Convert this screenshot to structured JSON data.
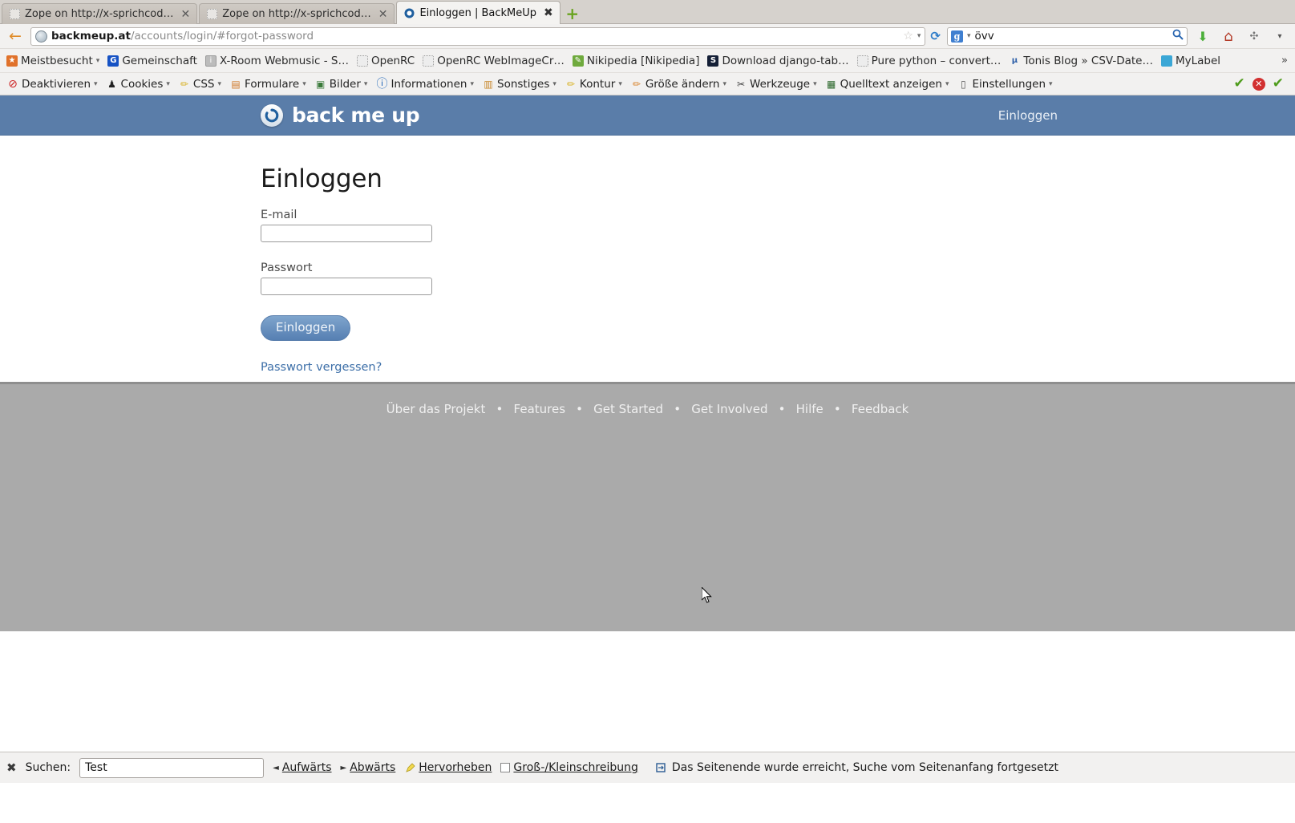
{
  "browser": {
    "tabs": [
      {
        "label": "Zope on http://x-sprichcod…",
        "active": false,
        "close": "✕",
        "favicon": "blank-favicon"
      },
      {
        "label": "Zope on http://x-sprichcod…",
        "active": false,
        "close": "✕",
        "favicon": "blank-favicon"
      },
      {
        "label": "Einloggen | BackMeUp",
        "active": true,
        "close": "✖",
        "favicon": "backmeup-favicon"
      }
    ],
    "new_tab_label": "+",
    "back_button": "←",
    "url": {
      "domain": "backmeup.at",
      "path": "/accounts/login/#forgot-password",
      "star": "☆",
      "caret": "▾",
      "reload": "⟳"
    },
    "search": {
      "engine_glyph": "g",
      "caret": "▾",
      "value": "övv",
      "magnifier": "🔍"
    },
    "nav_icons": [
      {
        "name": "downloads-icon",
        "glyph": "⬇",
        "color": "#4caf3a"
      },
      {
        "name": "home-icon",
        "glyph": "⌂",
        "color": "#b33a27"
      },
      {
        "name": "extension-icon",
        "glyph": "✣",
        "color": "#777777"
      },
      {
        "name": "overflow-caret-icon",
        "glyph": "▾",
        "color": "#555555"
      }
    ],
    "bookmarks": [
      {
        "label": "Meistbesucht",
        "icon": "f-orange",
        "glyph": "★",
        "caret": "▾"
      },
      {
        "label": "Gemeinschaft",
        "icon": "f-blue",
        "glyph": "G",
        "caret": ""
      },
      {
        "label": "X-Room Webmusic - S…",
        "icon": "f-gray",
        "glyph": "ⅰ",
        "caret": ""
      },
      {
        "label": "OpenRC",
        "icon": "f-dotted",
        "glyph": "",
        "caret": ""
      },
      {
        "label": "OpenRC WebImageCr…",
        "icon": "f-dotted",
        "glyph": "",
        "caret": ""
      },
      {
        "label": "Nikipedia [Nikipedia]",
        "icon": "f-green",
        "glyph": "✎",
        "caret": ""
      },
      {
        "label": "Download django-tab…",
        "icon": "f-dark",
        "glyph": "S",
        "caret": ""
      },
      {
        "label": "Pure python – convert…",
        "icon": "f-dotted",
        "glyph": "",
        "caret": ""
      },
      {
        "label": "Tonis Blog » CSV-Date…",
        "icon": "f-mu",
        "glyph": "μ",
        "caret": ""
      },
      {
        "label": "MyLabel",
        "icon": "f-cyan",
        "glyph": "●",
        "caret": ""
      }
    ],
    "bookmarks_overflow": "»",
    "devtoolbar": [
      {
        "label": "Deaktivieren",
        "glyph": "⊘",
        "color": "#cc2020",
        "caret": "▾"
      },
      {
        "label": "Cookies",
        "glyph": "♟",
        "color": "#333333",
        "caret": "▾"
      },
      {
        "label": "CSS",
        "glyph": "✏",
        "color": "#d8b020",
        "caret": "▾"
      },
      {
        "label": "Formulare",
        "glyph": "▤",
        "color": "#d07a2a",
        "caret": "▾"
      },
      {
        "label": "Bilder",
        "glyph": "▣",
        "color": "#3a7a3a",
        "caret": "▾"
      },
      {
        "label": "Informationen",
        "glyph": "ⓘ",
        "color": "#1d64b8",
        "caret": "▾"
      },
      {
        "label": "Sonstiges",
        "glyph": "▥",
        "color": "#c8872a",
        "caret": "▾"
      },
      {
        "label": "Kontur",
        "glyph": "✏",
        "color": "#d8b020",
        "caret": "▾"
      },
      {
        "label": "Größe ändern",
        "glyph": "✏",
        "color": "#d8822a",
        "caret": "▾"
      },
      {
        "label": "Werkzeuge",
        "glyph": "✂",
        "color": "#444444",
        "caret": "▾"
      },
      {
        "label": "Quelltext anzeigen",
        "glyph": "▦",
        "color": "#2f6a2f",
        "caret": "▾"
      },
      {
        "label": "Einstellungen",
        "glyph": "▯",
        "color": "#555555",
        "caret": "▾"
      }
    ],
    "devtoolbar_status": [
      {
        "name": "validation-ok-icon",
        "glyph": "✔"
      },
      {
        "name": "validation-error-icon",
        "glyph": "✕"
      },
      {
        "name": "validation-ok2-icon",
        "glyph": "✔"
      }
    ]
  },
  "page": {
    "brand_name": "back me up",
    "brand_icon": "backup-circle-arrow-icon",
    "nav_login": "Einloggen",
    "title": "Einloggen",
    "form": {
      "email_label": "E-mail",
      "email_value": "",
      "email_placeholder": "",
      "password_label": "Passwort",
      "password_value": "",
      "password_placeholder": "",
      "submit_label": "Einloggen",
      "forgot_label": "Passwort vergessen?"
    },
    "footer_links": [
      "Über das Projekt",
      "Features",
      "Get Started",
      "Get Involved",
      "Hilfe",
      "Feedback"
    ],
    "footer_separator": "•"
  },
  "findbar": {
    "close_glyph": "✖",
    "label": "Suchen:",
    "value": "Test",
    "placeholder": "",
    "prev_arrow": "◄",
    "prev_label": "Aufwärts",
    "next_arrow": "►",
    "next_label": "Abwärts",
    "highlight_glyph": "🖍",
    "highlight_label": "Hervorheben",
    "matchcase_label": "Groß-/Kleinschreibung",
    "status_icon": "wrap-search-icon",
    "status_text": "Das Seitenende wurde erreicht, Suche vom Seitenanfang fortgesetzt"
  },
  "colors": {
    "header_blue": "#5a7da9",
    "footer_gray": "#aaaaaa",
    "link_blue": "#3d6fa8",
    "chrome_gray": "#f2f1f0"
  }
}
